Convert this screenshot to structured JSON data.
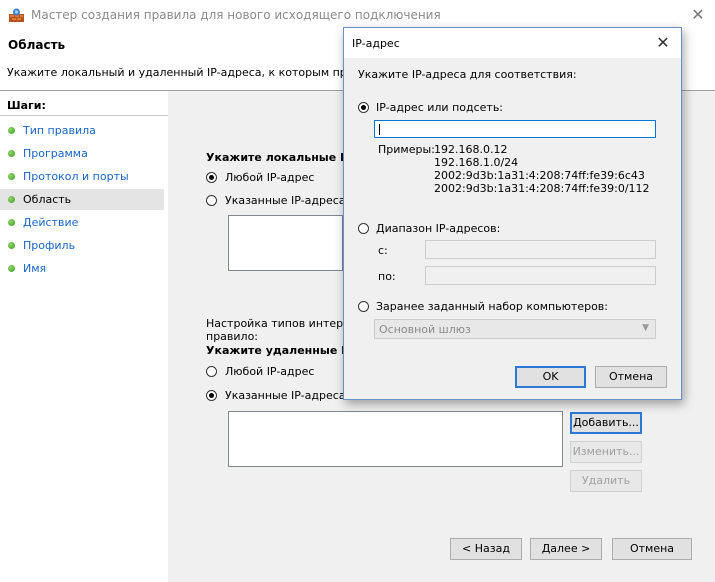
{
  "window": {
    "title": "Мастер создания правила для нового исходящего подключения",
    "header_title": "Область",
    "header_desc": "Укажите локальный и удаленный IP-адреса, к которым применяется"
  },
  "steps": {
    "caption": "Шаги:",
    "items": [
      "Тип правила",
      "Программа",
      "Протокол и порты",
      "Область",
      "Действие",
      "Профиль",
      "Имя"
    ],
    "current": "Область"
  },
  "content": {
    "local_heading": "Укажите локальные IP",
    "local_any": "Любой IP-адрес",
    "local_specified": "Указанные IP-адреса:",
    "iface_line1": "Настройка типов интерфей",
    "iface_line2": "правило:",
    "remote_heading": "Укажите удаленные IP",
    "remote_any": "Любой IP-адрес",
    "remote_specified": "Указанные IP-адреса:",
    "add_btn": "Добавить...",
    "edit_btn": "Изменить...",
    "delete_btn": "Удалить",
    "back_btn": "< Назад",
    "next_btn": "Далее >",
    "cancel_btn": "Отмена"
  },
  "dialog": {
    "title": "IP-адрес",
    "instruction": "Укажите IP-адреса для соответствия:",
    "option_subnet": "IP-адрес или подсеть:",
    "subnet_value": "",
    "examples_label": "Примеры:",
    "examples": [
      "192.168.0.12",
      "192.168.1.0/24",
      "2002:9d3b:1a31:4:208:74ff:fe39:6c43",
      "2002:9d3b:1a31:4:208:74ff:fe39:0/112"
    ],
    "option_range": "Диапазон IP-адресов:",
    "from_label": "с:",
    "to_label": "по:",
    "option_predefined": "Заранее заданный набор компьютеров:",
    "predefined_value": "Основной шлюз",
    "ok_btn": "OK",
    "cancel_btn": "Отмена"
  }
}
